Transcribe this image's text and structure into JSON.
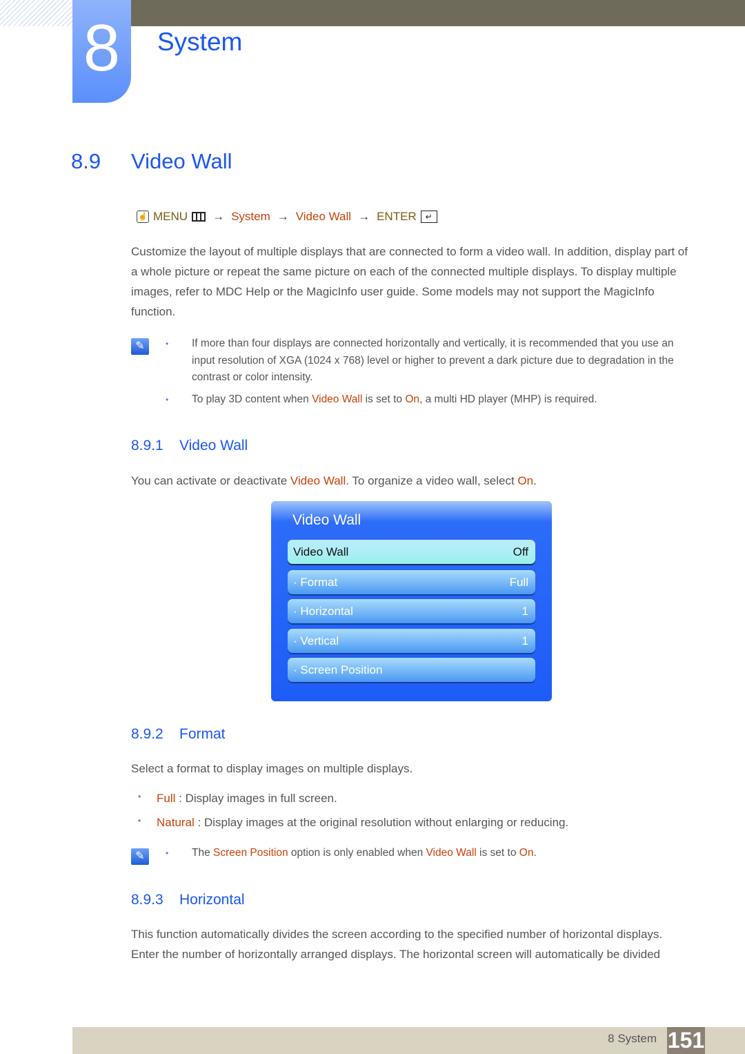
{
  "header": {
    "chapter_number": "8",
    "chapter_title": "System"
  },
  "section": {
    "number": "8.9",
    "title": "Video Wall"
  },
  "menu_path": {
    "menu": "MENU",
    "arrow": "→",
    "items": [
      "System",
      "Video Wall"
    ],
    "enter": "ENTER",
    "icons": [
      "hand-remote-icon",
      "menu-grid-icon",
      "enter-icon"
    ]
  },
  "intro": "Customize the layout of multiple displays that are connected to form a video wall. In addition, display part of a whole picture or repeat the same picture on each of the connected multiple displays. To display multiple images, refer to MDC Help or the MagicInfo user guide. Some models may not support the MagicInfo function.",
  "notes1": [
    {
      "text": "If more than four displays are connected horizontally and vertically, it is recommended that you use an input resolution of XGA (1024 x 768) level or higher to prevent a dark picture due to degradation in the contrast or color intensity."
    },
    {
      "pre": "To play 3D content when ",
      "hl1": "Video Wall",
      "mid": " is set to ",
      "hl2": "On",
      "post": ", a multi HD player (MHP) is required."
    }
  ],
  "sub1": {
    "number": "8.9.1",
    "title": "Video Wall",
    "text_pre": "You can activate or deactivate ",
    "text_hl1": "Video Wall",
    "text_mid": ". To organize a video wall, select ",
    "text_hl2": "On",
    "text_post": "."
  },
  "osd": {
    "title": "Video Wall",
    "items": [
      {
        "label": "Video Wall",
        "value": "Off",
        "selected": true
      },
      {
        "label": "· Format",
        "value": "Full"
      },
      {
        "label": "· Horizontal",
        "value": "1"
      },
      {
        "label": "· Vertical",
        "value": "1"
      },
      {
        "label": "· Screen Position",
        "value": ""
      }
    ]
  },
  "sub2": {
    "number": "8.9.2",
    "title": "Format",
    "text": "Select a format to display images on multiple displays.",
    "options": [
      {
        "name": "Full",
        "desc": " : Display images in full screen."
      },
      {
        "name": "Natural",
        "desc": " : Display images at the original resolution without enlarging or reducing."
      }
    ],
    "note": {
      "pre": "The ",
      "hl1": "Screen Position",
      "mid": " option is only enabled when ",
      "hl2": "Video Wall",
      "mid2": " is set to ",
      "hl3": "On",
      "post": "."
    }
  },
  "sub3": {
    "number": "8.9.3",
    "title": "Horizontal",
    "text": "This function automatically divides the screen according to the specified number of horizontal displays. Enter the number of horizontally arranged displays. The horizontal screen will automatically be divided"
  },
  "footer": {
    "label": "8 System",
    "page": "151"
  },
  "bullet": "•",
  "note_icon": "✎"
}
